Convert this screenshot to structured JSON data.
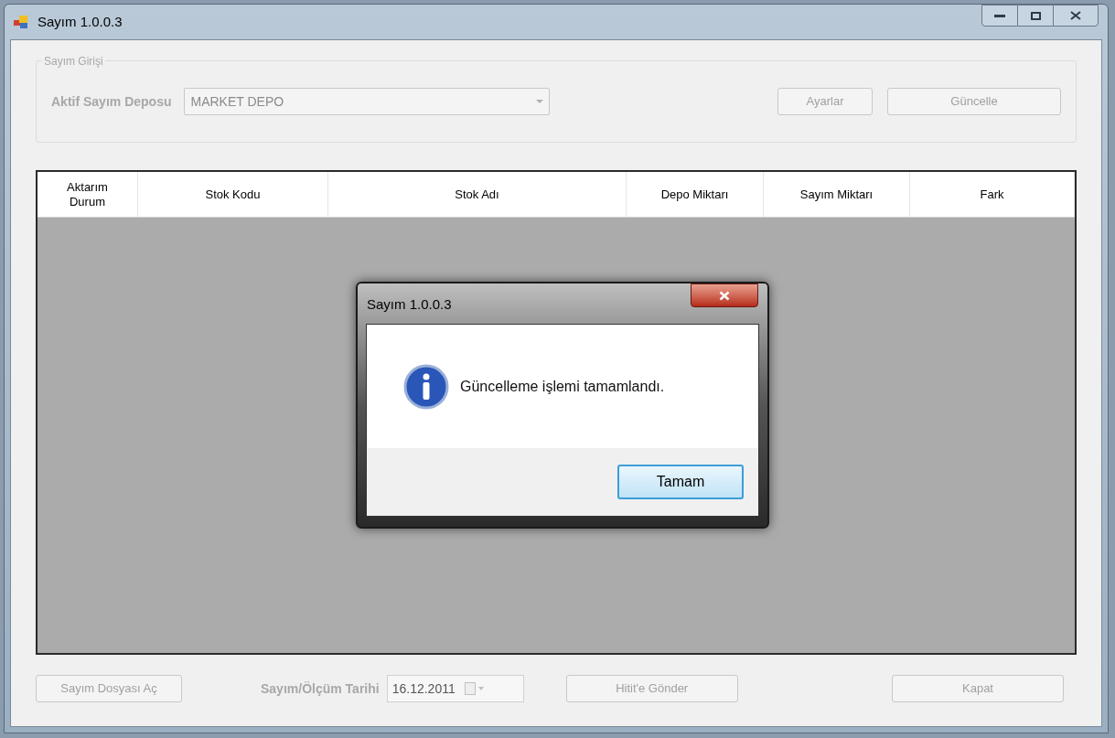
{
  "window": {
    "title": "Sayım 1.0.0.3"
  },
  "group": {
    "title": "Sayım Girişi",
    "label": "Aktif Sayım Deposu",
    "depot": {
      "value": "MARKET DEPO",
      "disabled": true
    },
    "buttons": [
      {
        "label": "Ayarlar",
        "disabled": true
      },
      {
        "label": "Güncelle",
        "disabled": true
      }
    ]
  },
  "table": {
    "columns": [
      "Aktarım Durum",
      "Stok Kodu",
      "Stok Adı",
      "Depo Miktarı",
      "Sayım Miktarı",
      "Fark"
    ]
  },
  "footer": {
    "open_button": {
      "label": "Sayım Dosyası Aç",
      "disabled": true
    },
    "date_label": "Sayım/Ölçüm Tarihi",
    "date": {
      "value": "16.12.2011",
      "disabled": true
    },
    "send_button": {
      "label": "Hitit'e Gönder",
      "disabled": true
    },
    "close_button": {
      "label": "Kapat",
      "disabled": true
    }
  },
  "dialog": {
    "title": "Sayım 1.0.0.3",
    "message": "Güncelleme işlemi tamamlandı.",
    "ok_button": {
      "label": "Tamam"
    }
  }
}
